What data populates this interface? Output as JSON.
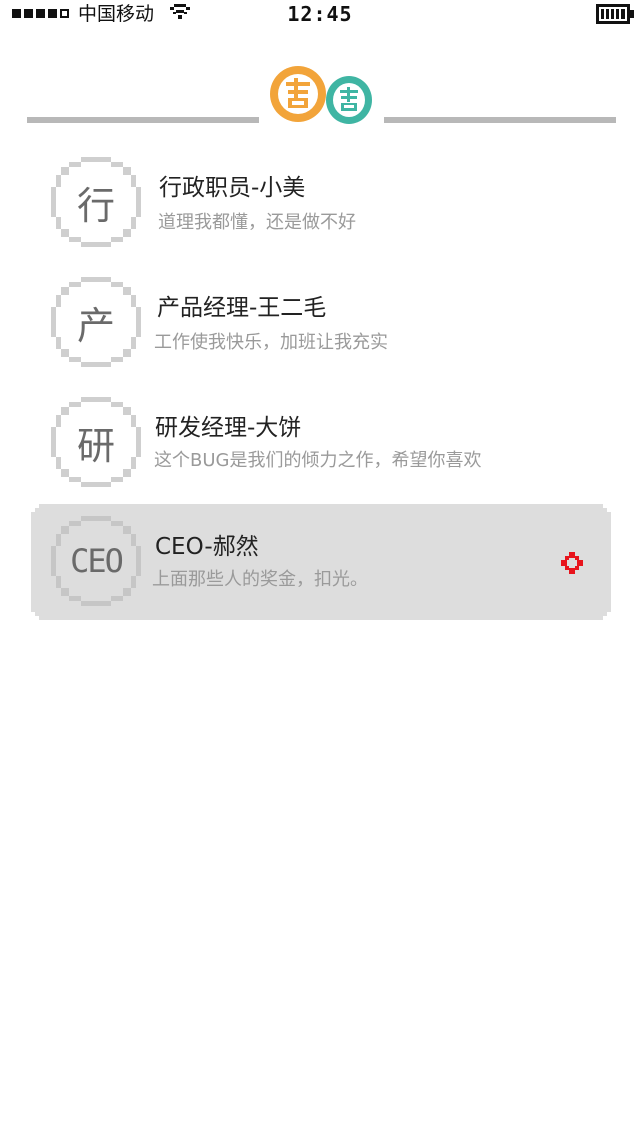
{
  "status_bar": {
    "carrier": "中国移动",
    "time": "12:45",
    "signal_bars_filled": 4,
    "signal_bars_total": 5
  },
  "header": {
    "logo_text": "圈圈",
    "logo_colors": [
      "#f2a43a",
      "#3fb5a3"
    ],
    "line_color": "#b8b8b8"
  },
  "items": [
    {
      "avatar": "行",
      "title": "行政职员-小美",
      "subtitle": "道理我都懂，还是做不好",
      "selected": false
    },
    {
      "avatar": "产",
      "title": "产品经理-王二毛",
      "subtitle": "工作使我快乐，加班让我充实",
      "selected": false
    },
    {
      "avatar": "研",
      "title": "研发经理-大饼",
      "subtitle": "这个BUG是我们的倾力之作，希望你喜欢",
      "selected": false
    },
    {
      "avatar": "CEO",
      "title": "CEO-郝然",
      "subtitle": "上面那些人的奖金，扣光。",
      "selected": true,
      "marker_icon": "red-pixel-cross-icon",
      "marker_color": "#e8141c"
    }
  ]
}
